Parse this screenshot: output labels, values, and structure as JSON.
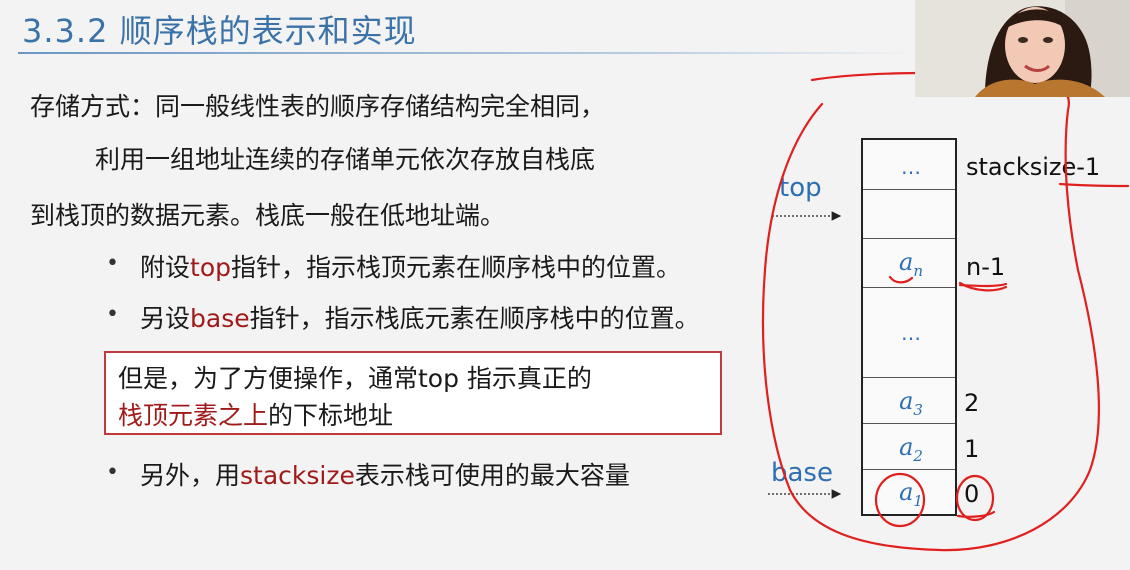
{
  "slide": {
    "title": "3.3.2 顺序栈的表示和实现",
    "lines": [
      "存储方式：同一般线性表的顺序存储结构完全相同，",
      "利用一组地址连续的存储单元依次存放自栈底",
      "到栈顶的数据元素。栈底一般在低地址端。"
    ],
    "bullets": [
      {
        "dot": "•",
        "pre": "附设",
        "hl": "top",
        "post": "指针，指示栈顶元素在顺序栈中的位置。"
      },
      {
        "dot": "•",
        "pre": "另设",
        "hl": "base",
        "post": "指针，指示栈底元素在顺序栈中的位置。"
      },
      {
        "dot": "•",
        "pre": "另外，用",
        "hl": "stacksize",
        "post": "表示栈可使用的最大容量"
      }
    ],
    "note": {
      "line1": "但是，为了方便操作，通常top 指示真正的",
      "line2_hl": "栈顶元素之上",
      "line2_post": "的下标地址"
    }
  },
  "diagram": {
    "top_label": "top",
    "base_label": "base",
    "cells": {
      "top_dots": "…",
      "an": "a",
      "an_sub": "n",
      "mid_dots": "…",
      "a3": "a",
      "a3_sub": "3",
      "a2": "a",
      "a2_sub": "2",
      "a1": "a",
      "a1_sub": "1"
    },
    "indices": {
      "top": "stacksize-1",
      "an": "n-1",
      "a3": "2",
      "a2": "1",
      "a1": "0"
    }
  },
  "colors": {
    "title": "#3b73a8",
    "highlight": "#a01a1a",
    "annotation_ink": "#e0201e",
    "diagram_blue": "#2c6fb3"
  }
}
